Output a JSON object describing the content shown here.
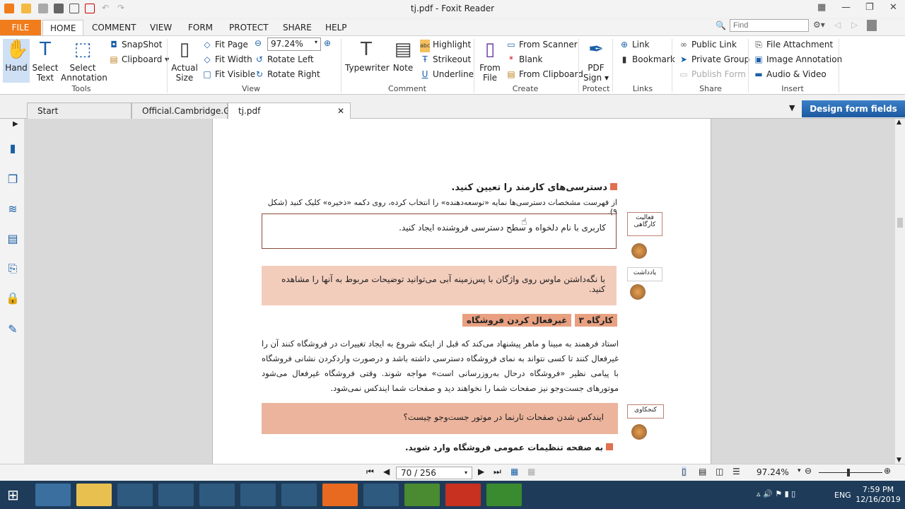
{
  "window": {
    "title": "tj.pdf - Foxit Reader"
  },
  "menu": {
    "tabs": [
      "FILE",
      "HOME",
      "COMMENT",
      "VIEW",
      "FORM",
      "PROTECT",
      "SHARE",
      "HELP"
    ]
  },
  "search": {
    "placeholder": "Find"
  },
  "ribbon": {
    "tools": {
      "hand": "Hand",
      "select_text": "Select Text",
      "select_annotation": "Select Annotation",
      "snapshot": "SnapShot",
      "clipboard": "Clipboard",
      "label": "Tools"
    },
    "view": {
      "actual_size": "Actual Size",
      "fit_page": "Fit Page",
      "fit_width": "Fit Width",
      "fit_visible": "Fit Visible",
      "zoom": "97.24%",
      "rotate_left": "Rotate Left",
      "rotate_right": "Rotate Right",
      "label": "View"
    },
    "comment": {
      "typewriter": "Typewriter",
      "note": "Note",
      "highlight": "Highlight",
      "strikeout": "Strikeout",
      "underline": "Underline",
      "label": "Comment"
    },
    "create": {
      "from_file": "From File",
      "from_scanner": "From Scanner",
      "blank": "Blank",
      "from_clipboard": "From Clipboard",
      "label": "Create"
    },
    "protect": {
      "pdf_sign": "PDF Sign",
      "label": "Protect"
    },
    "links": {
      "link": "Link",
      "bookmark": "Bookmark",
      "label": "Links"
    },
    "share": {
      "public_link": "Public Link",
      "private_group": "Private Group",
      "publish_form": "Publish Form",
      "label": "Share"
    },
    "insert": {
      "file_attachment": "File Attachment",
      "image_annotation": "Image Annotation",
      "audio_video": "Audio & Video",
      "label": "Insert"
    }
  },
  "doc_tabs": [
    "Start",
    "Official.Cambridge.Gu...",
    "tj.pdf"
  ],
  "promo": "Design form fields easily",
  "document": {
    "step3_heading": "دسترسی‌های کارمند را تعیین کنید.",
    "step3_text": "از فهرست مشخصات دسترسی‌ها نمایه «توسعه‌دهنده» را انتخاب کرده، روی دکمه «ذخیره» کلیک کنید (شکل ۹).",
    "activity_text": "کاربری با نام دلخواه و سطح دسترسی فروشنده ایجاد کنید.",
    "activity_label": "فعالیت کارگاهی",
    "note_text": "با نگه‌داشتن ماوس روی واژگان با پس‌زمینه آبی می‌توانید توضیحات مربوط به آنها را مشاهده کنید.",
    "note_label": "یادداشت",
    "workshop_number": "کارگاه ۳",
    "workshop_title": "غیرفعال کردن فروشگاه",
    "paragraph": "استاد فرهمند به مبینا و ماهر پیشنهاد می‌کند که  قبل از اینکه شروع به ایجاد تغییرات در فروشگاه کنند آن را غیرفعال کنند تا کسی نتواند به نمای فروشگاه دسترسی داشته باشد و درصورت واردکردن نشانی فروشگاه با پیامی نظیر «فروشگاه درحال به‌روزرسانی است» مواجه شوند. وقتی فروشگاه غیرفعال می‌شود موتورهای جست‌وجو نیز صفحات شما را نخواهند دید و صفحات شما ایندکس نمی‌شود.",
    "curiosity_text": "ایندکس شدن صفحات تارنما در موتور جست‌وجو چیست؟",
    "curiosity_label": "کنجکاوی",
    "step1_heading": "به صفحه تنظیمات عمومی فروشگاه وارد شوید."
  },
  "status": {
    "page": "70 / 256",
    "zoom": "97.24%"
  },
  "taskbar": {
    "lang": "ENG",
    "time": "7:59 PM",
    "date": "12/16/2019"
  }
}
